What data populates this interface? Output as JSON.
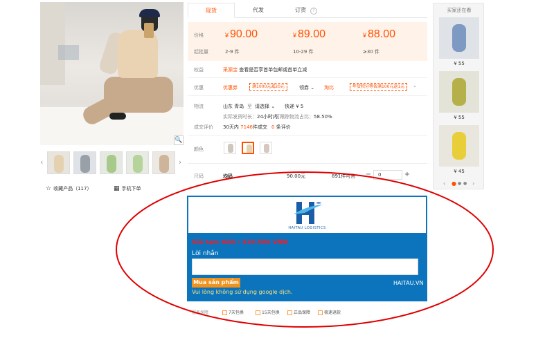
{
  "gallery": {
    "thumbs_count": 5,
    "collect_label": "收藏产品（117）",
    "mobile_order_label": "手机下单"
  },
  "tabs": [
    {
      "label": "现货"
    },
    {
      "label": "代发"
    },
    {
      "label": "订货"
    }
  ],
  "price": {
    "price_label": "价格",
    "qty_label": "起批量",
    "currency": "¥",
    "tiers": [
      {
        "price": "90.00",
        "qty": "2-9 件"
      },
      {
        "price": "89.00",
        "qty": "10-29 件"
      },
      {
        "price": "88.00",
        "qty": "≥30 件"
      }
    ]
  },
  "rights": {
    "label": "权益",
    "badge": "采源宝",
    "text": "查看是否享首单包邮或首单立减"
  },
  "promo": {
    "label": "优惠",
    "coupon_title": "优惠券",
    "coupon_value": "满1000元减20元",
    "dropdown": "领券",
    "discount_title": "淘比",
    "discount_value": "年货积分等各满100元返1元"
  },
  "logistics": {
    "label": "物流",
    "origin": "山东 青岛",
    "to": "至",
    "destination": "请选择",
    "express": "快递 ¥ 5",
    "ship_time_label": "实际发货时长：",
    "ship_time": "24小时内",
    "ship_rate_label": "可跟踪物流占比：",
    "ship_rate": "58.50%"
  },
  "deals": {
    "label": "成交评价",
    "deals_prefix": "30天内",
    "deals_count": "7146",
    "deals_suffix": "件成交",
    "reviews_count": "0",
    "reviews_suffix": "条评价"
  },
  "color": {
    "label": "颜色",
    "swatches": [
      "#cfc7bd",
      "#e4d1b0",
      "#d6c8bf"
    ]
  },
  "size": {
    "label": "尺码",
    "value": "均码",
    "price": "90.00元",
    "stock": "891件可售",
    "qty": "0",
    "minus": "−",
    "plus": "+"
  },
  "recommend": {
    "title": "买家还在看",
    "items": [
      {
        "price": "¥ 55"
      },
      {
        "price": "¥ 55"
      },
      {
        "price": "¥ 45"
      }
    ]
  },
  "haitau": {
    "logo_text": "HAITAU LOGISTICS",
    "price_text": "Giá tạm tính : 310.500 VNĐ",
    "message_label": "Lời nhắn",
    "message_value": "",
    "buy_button": "Mua sản phẩm",
    "site": "HAITAU.VN",
    "note": "Vui lòng không sử dụng google dịch."
  },
  "service": {
    "label": "服务保障",
    "items": [
      "7天包换",
      "15天包换",
      "正品保障",
      "极速退款"
    ]
  },
  "colors": {
    "accent": "#ff5000",
    "banner_blue": "#0b74bc",
    "circle_red": "#e00000",
    "buy_orange": "#f0931e"
  }
}
